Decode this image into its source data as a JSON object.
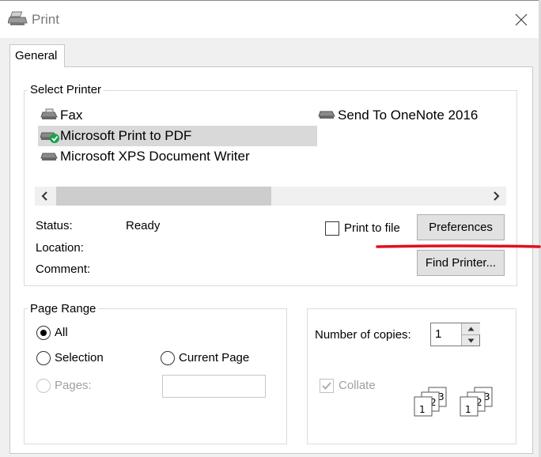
{
  "window": {
    "title": "Print"
  },
  "tabs": [
    {
      "label": "General"
    }
  ],
  "select_printer": {
    "label": "Select Printer",
    "printers": [
      {
        "name": "Fax"
      },
      {
        "name": "Microsoft Print to PDF"
      },
      {
        "name": "Microsoft XPS Document Writer"
      },
      {
        "name": "Send To OneNote 2016"
      }
    ],
    "selected_printer": "Microsoft Print to PDF",
    "status_label": "Status:",
    "status_value": "Ready",
    "location_label": "Location:",
    "comment_label": "Comment:",
    "print_to_file_label": "Print to file",
    "preferences_label": "Preferences",
    "find_printer_label": "Find Printer..."
  },
  "page_range": {
    "label": "Page Range",
    "all_label": "All",
    "selection_label": "Selection",
    "current_page_label": "Current Page",
    "pages_label": "Pages:",
    "selected": "All"
  },
  "copies": {
    "number_label": "Number of copies:",
    "number_value": "1",
    "collate_label": "Collate",
    "collate_checked": true
  },
  "annotation": {
    "color": "#e0101e"
  }
}
